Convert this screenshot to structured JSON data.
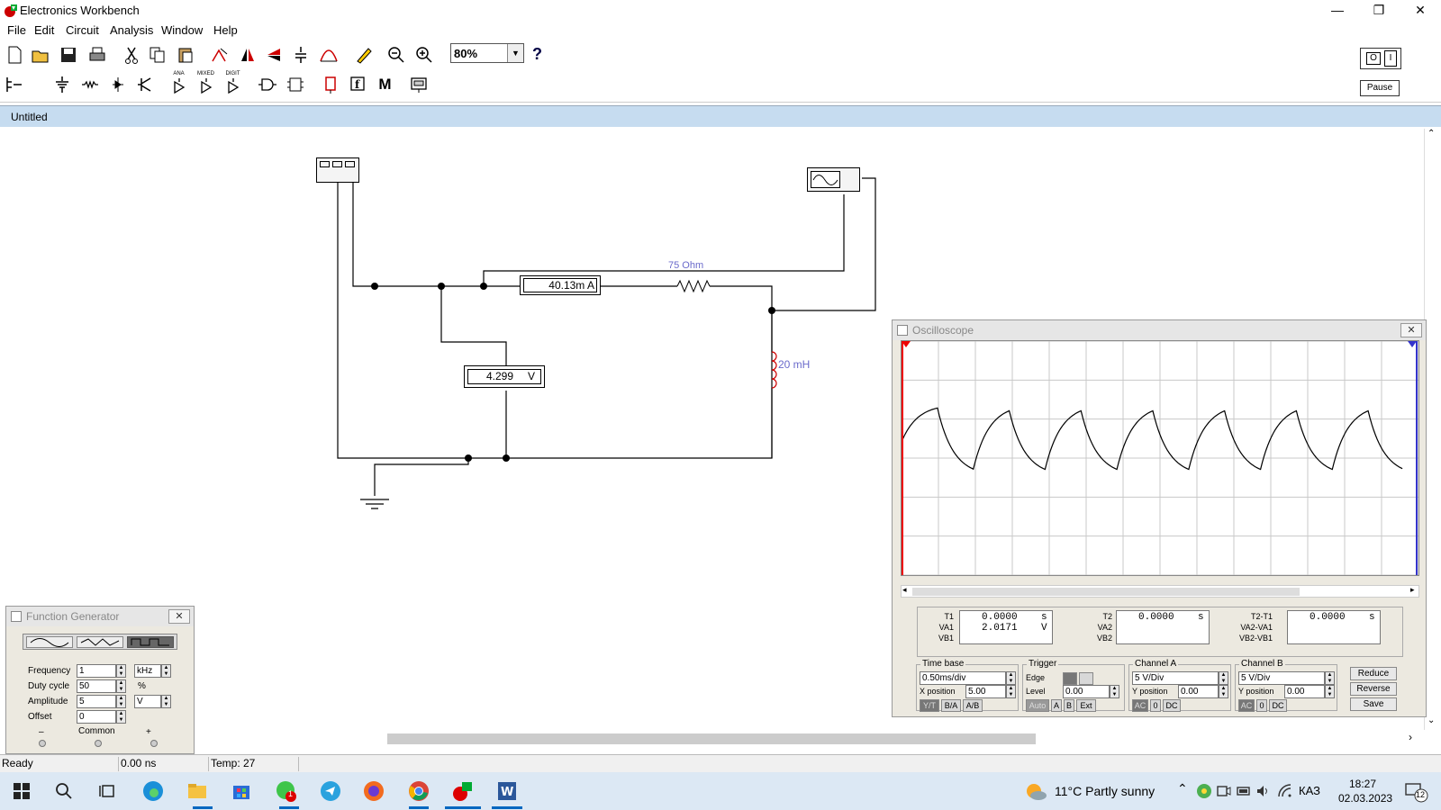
{
  "app": {
    "title": "Electronics Workbench"
  },
  "menu": [
    "File",
    "Edit",
    "Circuit",
    "Analysis",
    "Window",
    "Help"
  ],
  "toolbar": {
    "zoom": "80%",
    "help": "?",
    "pause_label": "Pause",
    "ana_label": "ANA",
    "mixed_label": "MIXED",
    "digit_label": "DIGIT",
    "m_label": "M",
    "f_label": "f"
  },
  "document": {
    "title": "Untitled"
  },
  "circuit": {
    "ammeter_reading": "40.13m",
    "ammeter_unit": "A",
    "voltmeter_reading": "4.299",
    "voltmeter_unit": "V",
    "resistor_label": "75 Ohm",
    "inductor_label": "20 mH"
  },
  "function_generator": {
    "title": "Function Generator",
    "rows": [
      {
        "label": "Frequency",
        "value": "1",
        "unit": "kHz"
      },
      {
        "label": "Duty cycle",
        "value": "50",
        "unit": "%"
      },
      {
        "label": "Amplitude",
        "value": "5",
        "unit": "V"
      },
      {
        "label": "Offset",
        "value": "0",
        "unit": ""
      }
    ],
    "minus": "–",
    "common": "Common",
    "plus": "+"
  },
  "oscilloscope": {
    "title": "Oscilloscope",
    "t1": {
      "labels": "T1\nVA1\nVB1",
      "time": "0.0000",
      "time_unit": "s",
      "va": "2.0171",
      "va_unit": "V"
    },
    "t2": {
      "labels": "T2\nVA2\nVB2",
      "time": "0.0000",
      "time_unit": "s"
    },
    "t2t1": {
      "labels": "T2-T1\nVA2-VA1\nVB2-VB1",
      "time": "0.0000",
      "time_unit": "s"
    },
    "timebase": {
      "label": "Time base",
      "value": "0.50ms/div",
      "xpos_label": "X position",
      "xpos": "5.00",
      "btn_yt": "Y/T",
      "btn_ba": "B/A",
      "btn_ab": "A/B"
    },
    "trigger": {
      "label": "Trigger",
      "edge_label": "Edge",
      "level_label": "Level",
      "level": "0.00",
      "btn_auto": "Auto",
      "btn_a": "A",
      "btn_b": "B",
      "btn_ext": "Ext"
    },
    "channel_a": {
      "label": "Channel A",
      "value": "5 V/Div",
      "ypos_label": "Y position",
      "ypos": "0.00",
      "ac": "AC",
      "zero": "0",
      "dc": "DC"
    },
    "channel_b": {
      "label": "Channel B",
      "value": "5 V/Div",
      "ypos_label": "Y position",
      "ypos": "0.00",
      "ac": "AC",
      "zero": "0",
      "dc": "DC"
    },
    "buttons": [
      "Reduce",
      "Reverse",
      "Save"
    ],
    "waveform": {
      "cycles": 7,
      "color": "#000000"
    }
  },
  "status": {
    "state": "Ready",
    "time": "0.00 ns",
    "temp": "Temp:  27"
  },
  "taskbar": {
    "weather": "11°C  Partly sunny",
    "lang": "КАЗ",
    "time": "18:27",
    "date": "02.03.2023",
    "notif": "12",
    "whatsapp_badge": "1"
  }
}
